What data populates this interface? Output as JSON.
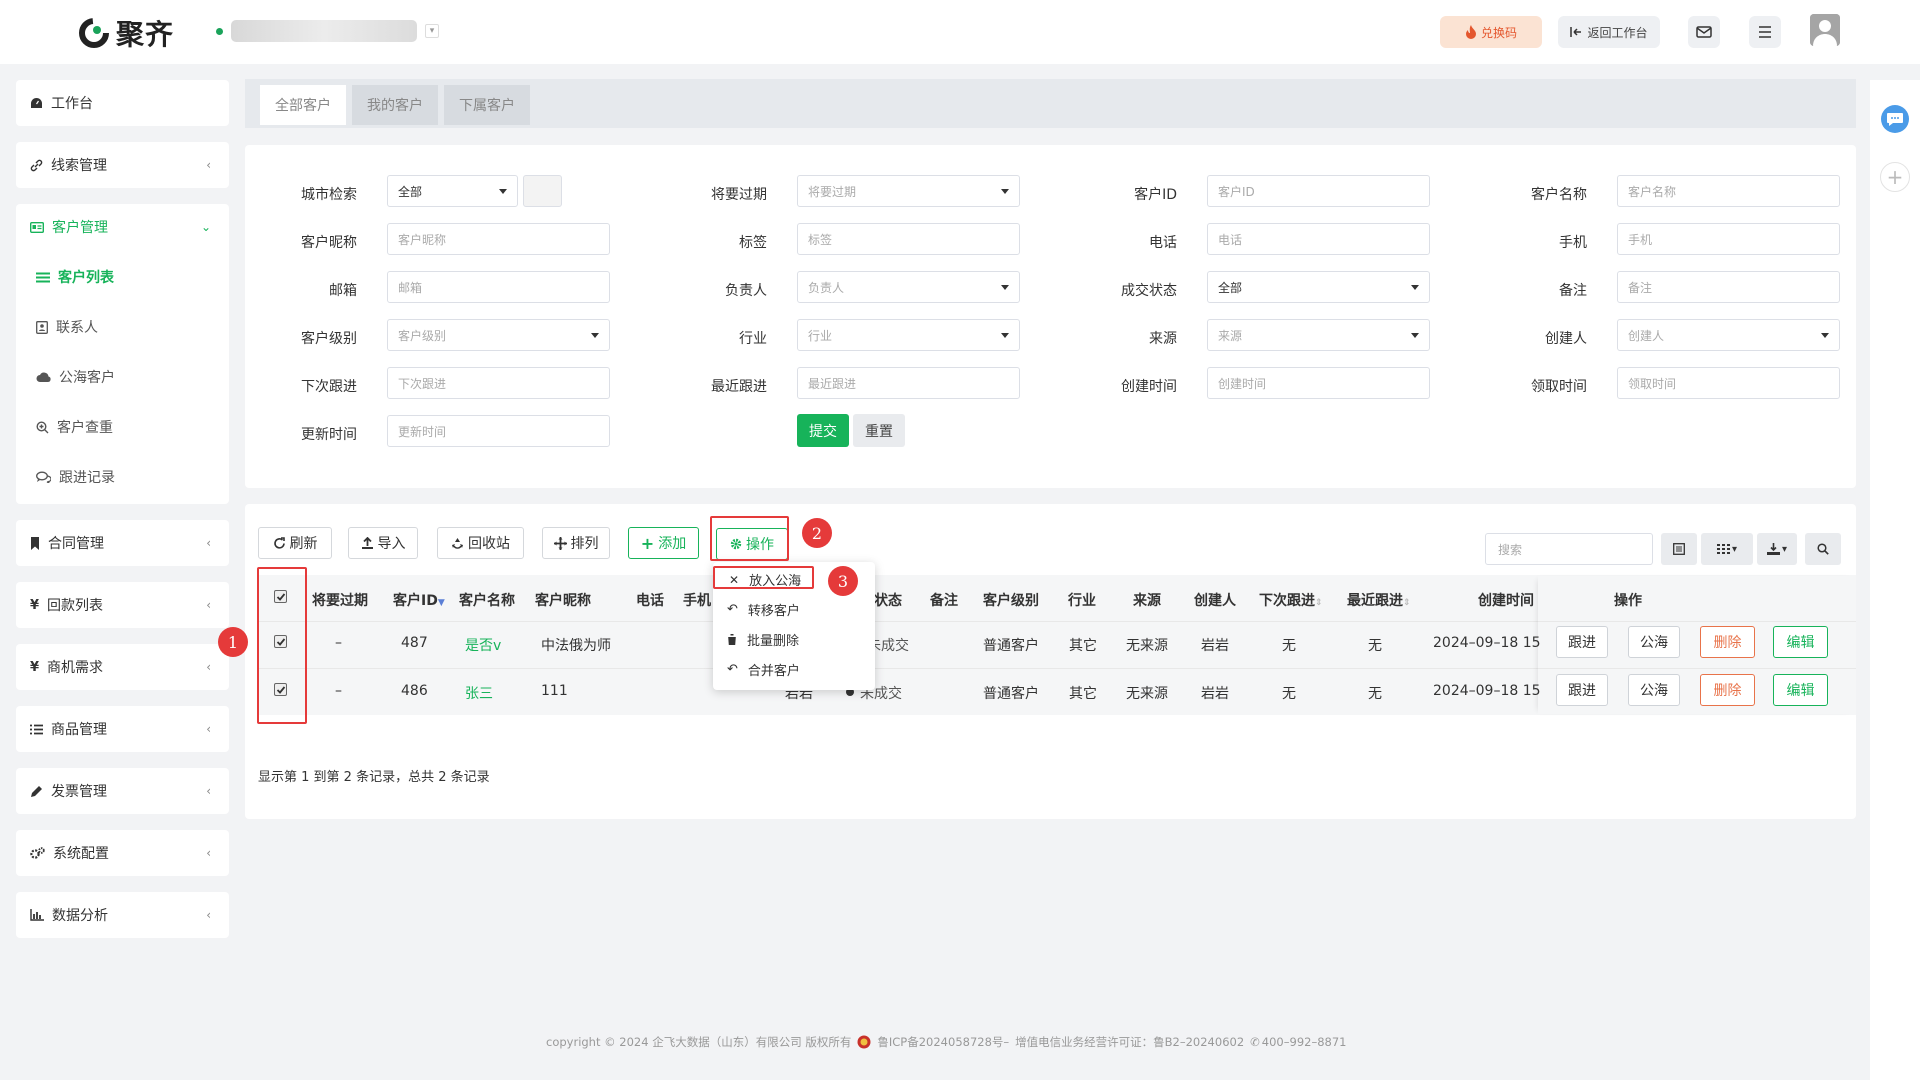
{
  "app": {
    "brand": "聚齐"
  },
  "topbar": {
    "redeem_label": "兑换码",
    "back_label": "返回工作台",
    "mail_icon": "mail-icon",
    "menu_icon": "menu-icon"
  },
  "sidebar": {
    "workbench": "工作台",
    "leads": "线索管理",
    "customers": "客户管理",
    "customer_sub": {
      "list": "客户列表",
      "contacts": "联系人",
      "public_pool": "公海客户",
      "dedupe": "客户查重",
      "followups": "跟进记录"
    },
    "contracts": "合同管理",
    "payments": "回款列表",
    "opportunities": "商机需求",
    "products": "商品管理",
    "invoices": "发票管理",
    "settings": "系统配置",
    "analytics": "数据分析"
  },
  "tabs": [
    "全部客户",
    "我的客户",
    "下属客户"
  ],
  "filters": {
    "city": {
      "label": "城市检索",
      "value": "全部"
    },
    "expiring": {
      "label": "将要过期",
      "placeholder": "将要过期"
    },
    "customer_id": {
      "label": "客户ID",
      "placeholder": "客户ID"
    },
    "customer_name": {
      "label": "客户名称",
      "placeholder": "客户名称"
    },
    "nickname": {
      "label": "客户昵称",
      "placeholder": "客户昵称"
    },
    "tag": {
      "label": "标签",
      "placeholder": "标签"
    },
    "phone": {
      "label": "电话",
      "placeholder": "电话"
    },
    "mobile": {
      "label": "手机",
      "placeholder": "手机"
    },
    "email": {
      "label": "邮箱",
      "placeholder": "邮箱"
    },
    "owner": {
      "label": "负责人",
      "placeholder": "负责人"
    },
    "deal_status": {
      "label": "成交状态",
      "value": "全部"
    },
    "remark": {
      "label": "备注",
      "placeholder": "备注"
    },
    "level": {
      "label": "客户级别",
      "placeholder": "客户级别"
    },
    "industry": {
      "label": "行业",
      "placeholder": "行业"
    },
    "source": {
      "label": "来源",
      "placeholder": "来源"
    },
    "creator": {
      "label": "创建人",
      "placeholder": "创建人"
    },
    "next_follow": {
      "label": "下次跟进",
      "placeholder": "下次跟进"
    },
    "last_follow": {
      "label": "最近跟进",
      "placeholder": "最近跟进"
    },
    "created_at": {
      "label": "创建时间",
      "placeholder": "创建时间"
    },
    "claimed_at": {
      "label": "领取时间",
      "placeholder": "领取时间"
    },
    "updated_at": {
      "label": "更新时间",
      "placeholder": "更新时间"
    },
    "submit": "提交",
    "reset": "重置"
  },
  "toolbar": {
    "refresh": "刷新",
    "import": "导入",
    "recycle": "回收站",
    "sort": "排列",
    "add": "添加",
    "actions": "操作",
    "search_placeholder": "搜索"
  },
  "actions_menu": [
    "放入公海",
    "转移客户",
    "批量删除",
    "合并客户"
  ],
  "annotations": [
    "1",
    "2",
    "3"
  ],
  "table": {
    "headers": [
      "将要过期",
      "客户ID",
      "客户名称",
      "客户昵称",
      "电话",
      "手机",
      "状态",
      "备注",
      "客户级别",
      "行业",
      "来源",
      "创建人",
      "下次跟进",
      "最近跟进",
      "创建时间",
      "操作"
    ],
    "rows": [
      {
        "expiring": "–",
        "id": "487",
        "name": "是否v",
        "nickname": "中法俄为师",
        "owner": "",
        "status": "未成交",
        "level": "普通客户",
        "industry": "其它",
        "source": "无来源",
        "creator": "岩岩",
        "next": "无",
        "last": "无",
        "created": "2024–09–18 15"
      },
      {
        "expiring": "–",
        "id": "486",
        "name": "张三",
        "nickname": "111",
        "owner": "岩岩",
        "status": "未成交",
        "level": "普通客户",
        "industry": "其它",
        "source": "无来源",
        "creator": "岩岩",
        "next": "无",
        "last": "无",
        "created": "2024–09–18 15"
      }
    ],
    "row_actions": {
      "follow": "跟进",
      "pool": "公海",
      "delete": "删除",
      "edit": "编辑"
    },
    "summary": "显示第 1 到第 2 条记录，总共 2 条记录"
  },
  "footer": {
    "copyright": "copyright © 2024 企飞大数据（山东）有限公司 版权所有",
    "icp": "鲁ICP备2024058728号–",
    "license": "增值电信业务经营许可证：鲁B2–20240602",
    "phone": "400–992–8871"
  },
  "colors": {
    "accent": "#17b35a",
    "danger": "#e53a3a",
    "delete": "#e8734a"
  }
}
